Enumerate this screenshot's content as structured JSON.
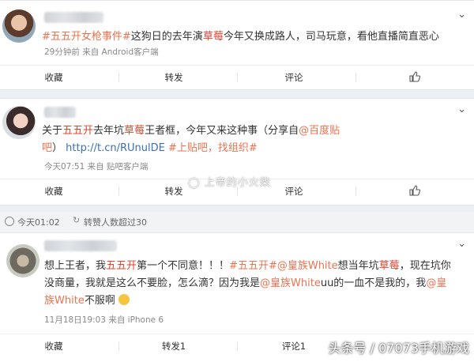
{
  "post1": {
    "text_a": "#五五开女枪事件#",
    "text_b": "这狗日的去年演",
    "text_c": "草莓",
    "text_d": "今年又换成路人，司马玩意，看他直播简直恶心",
    "meta": "29分钟前 来自 Android客户端",
    "actions": {
      "collect": "收藏",
      "repost": "转发",
      "comment": "评论"
    }
  },
  "post2": {
    "text_a": "关于",
    "text_b": "五五开",
    "text_c": "去年坑",
    "text_d": "草莓",
    "text_e": "王者框，今年又来这种事（分享自",
    "text_f": "@百度贴吧",
    "text_g": "）",
    "text_h": "http://t.cn/RUnulDE",
    "text_i": "#上贴吧，找组织#",
    "meta": "今天07:51 来自 贴吧客户端",
    "actions": {
      "collect": "收藏",
      "repost": "转发",
      "comment": "评论"
    }
  },
  "bar": {
    "time": "今天01:02",
    "status": "转赞人数超过30"
  },
  "post3": {
    "t1": "想上王者，我",
    "t2": "五五开",
    "t3": "第一个不同意！！！",
    "t4": "#五五开#",
    "t5": "@皇族White",
    "t6": "想当年坑",
    "t7": "草莓",
    "t8": "，现在坑你没商量，我就是这么不要脸，怎么滴？因为我是",
    "t9": "@皇族White",
    "t10": "uu的一血不是我的，我",
    "t11": "@皇族White",
    "t12": "不服啊",
    "meta": "11月18日19:03 来自 iPhone 6",
    "actions": {
      "collect": "收藏",
      "repost": "转发1",
      "comment": "评论1"
    }
  },
  "watermark": {
    "center": "上帝的小火柴",
    "corner": "头条号 / 07073手机游戏"
  },
  "colors": {
    "link": "#eb7350",
    "url": "#3b6fb6",
    "red": "#e0452e"
  }
}
